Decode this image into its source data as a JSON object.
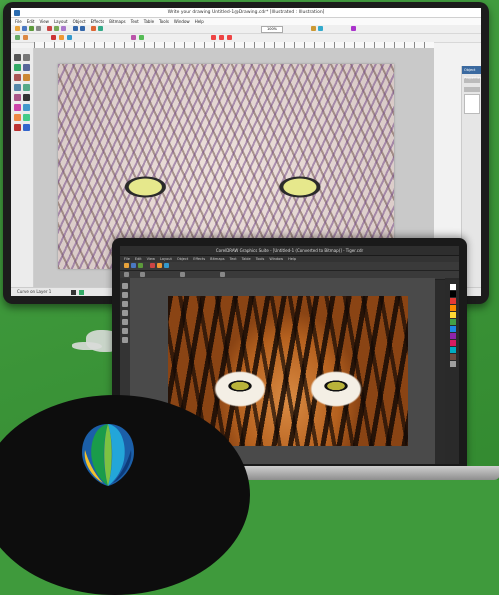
{
  "monitor": {
    "window_title": "Write your drawing Untitled-1@Drawing.cdr* [Illustrated : Illustration]",
    "menu": [
      "File",
      "Edit",
      "View",
      "Layout",
      "Object",
      "Effects",
      "Bitmaps",
      "Text",
      "Table",
      "Tools",
      "Window",
      "Help"
    ],
    "zoom": "100%",
    "docker_title": "Object Properties",
    "status": "Curve on Layer 1"
  },
  "laptop": {
    "window_title": "CorelDRAW Graphics Suite - [Untitled-1 (Converted to Bitmap)] - Tiger.cdr",
    "menu": [
      "File",
      "Edit",
      "View",
      "Layout",
      "Object",
      "Effects",
      "Bitmaps",
      "Text",
      "Table",
      "Tools",
      "Window",
      "Help"
    ]
  },
  "colors": {
    "background_green": "#3f9a3c",
    "balloon": [
      "#1a9c4a",
      "#7cc242",
      "#23a6d9",
      "#f2c12e",
      "#1b5fa8"
    ]
  }
}
